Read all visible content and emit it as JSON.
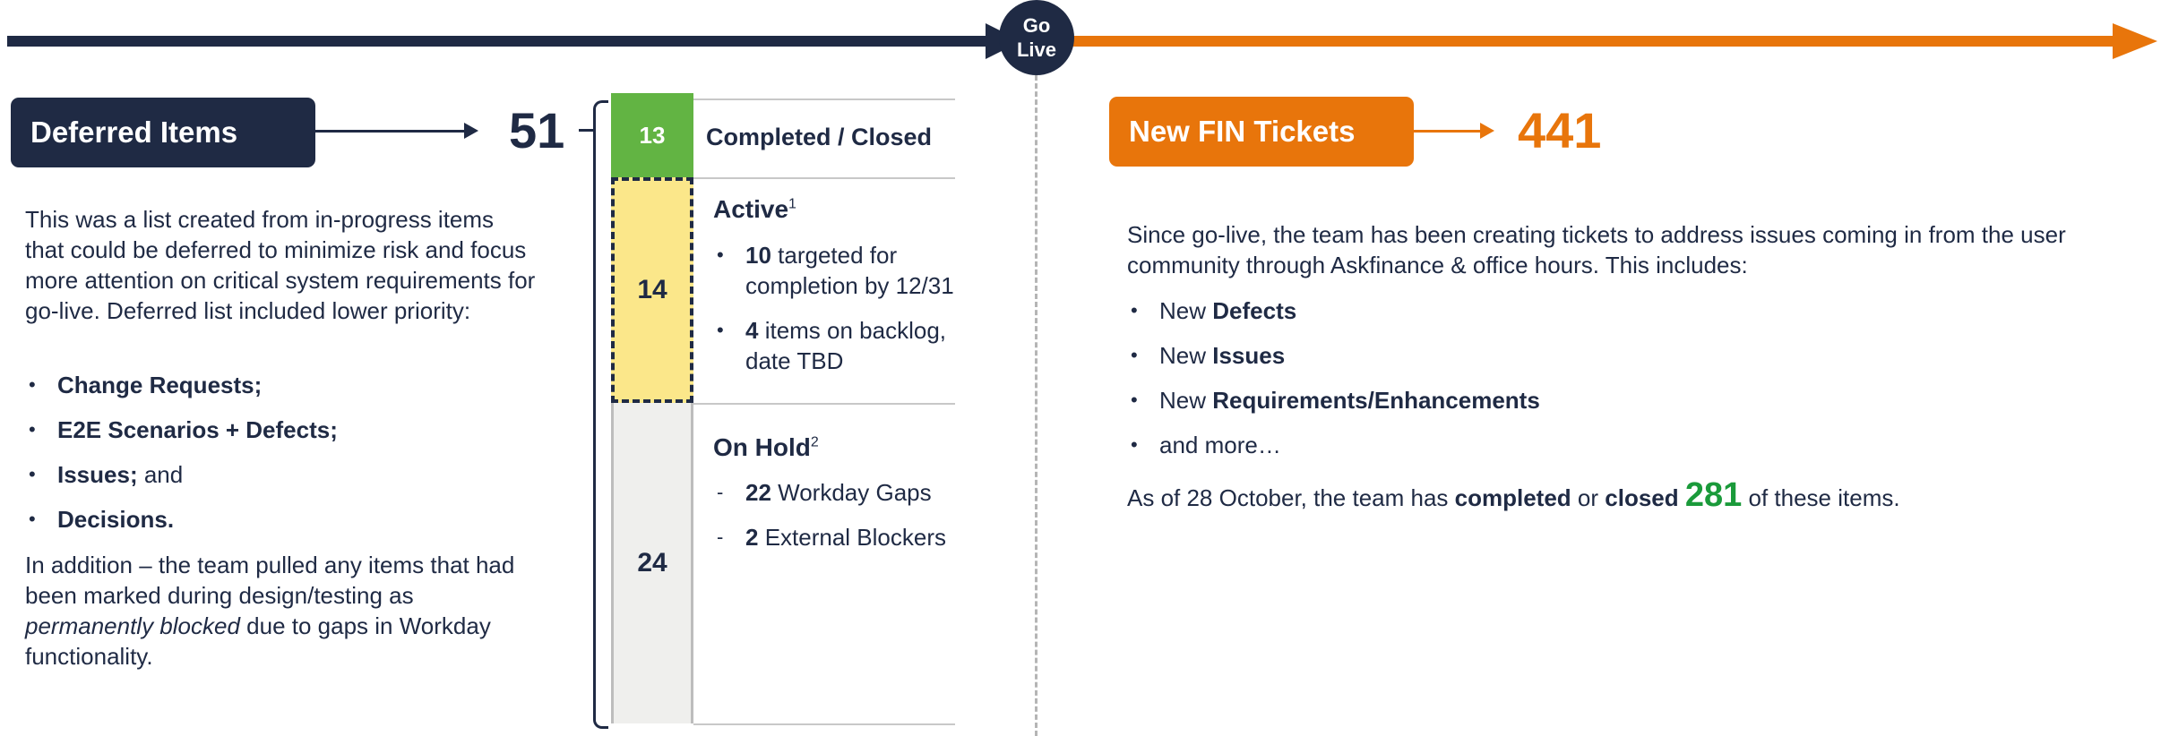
{
  "timeline": {
    "golive_line1": "Go",
    "golive_line2": "Live"
  },
  "deferred": {
    "title": "Deferred Items",
    "count": "51",
    "intro": "This was a list created from in-progress items that could be deferred to minimize risk and focus more attention on critical system requirements for go-live. Deferred list included lower priority:",
    "bullets": [
      {
        "bold": "Change Requests;",
        "rest": ""
      },
      {
        "bold": "E2E Scenarios + Defects;",
        "rest": ""
      },
      {
        "bold": "Issues;",
        "rest": " and"
      },
      {
        "bold": "Decisions.",
        "rest": ""
      }
    ],
    "addition_pre": "In addition – the team pulled any items that had been marked during design/testing as ",
    "addition_italic": "permanently blocked",
    "addition_post": " due to gaps in Workday functionality."
  },
  "breakdown": {
    "completed": {
      "count": "13",
      "label": "Completed / Closed"
    },
    "active": {
      "count": "14",
      "title": "Active",
      "footnote": "1",
      "items": [
        {
          "num": "10",
          "text": " targeted for completion by 12/31"
        },
        {
          "num": "4",
          "text": " items on backlog, date TBD"
        }
      ]
    },
    "on_hold": {
      "count": "24",
      "title": "On Hold",
      "footnote": "2",
      "items": [
        {
          "num": "22",
          "text": " Workday Gaps"
        },
        {
          "num": "2",
          "text": " External Blockers"
        }
      ]
    }
  },
  "fin": {
    "title": "New FIN Tickets",
    "count": "441",
    "intro": "Since go-live, the team has been creating tickets to address issues coming in from the user community through Askfinance & office hours. This includes:",
    "bullets": [
      {
        "pre": "New ",
        "bold": "Defects"
      },
      {
        "pre": "New ",
        "bold": "Issues"
      },
      {
        "pre": "New ",
        "bold": "Requirements/Enhancements"
      },
      {
        "pre": "and more…",
        "bold": ""
      }
    ],
    "status_pre": "As of 28 October, the team has ",
    "status_b1": "completed",
    "status_mid": " or ",
    "status_b2": "closed",
    "status_num": "281",
    "status_post": " of these items."
  },
  "colors": {
    "navy": "#1f2a44",
    "orange": "#e8750b",
    "green": "#62b443",
    "yellow": "#fbe78a",
    "highlight_green": "#1a9a3a"
  }
}
